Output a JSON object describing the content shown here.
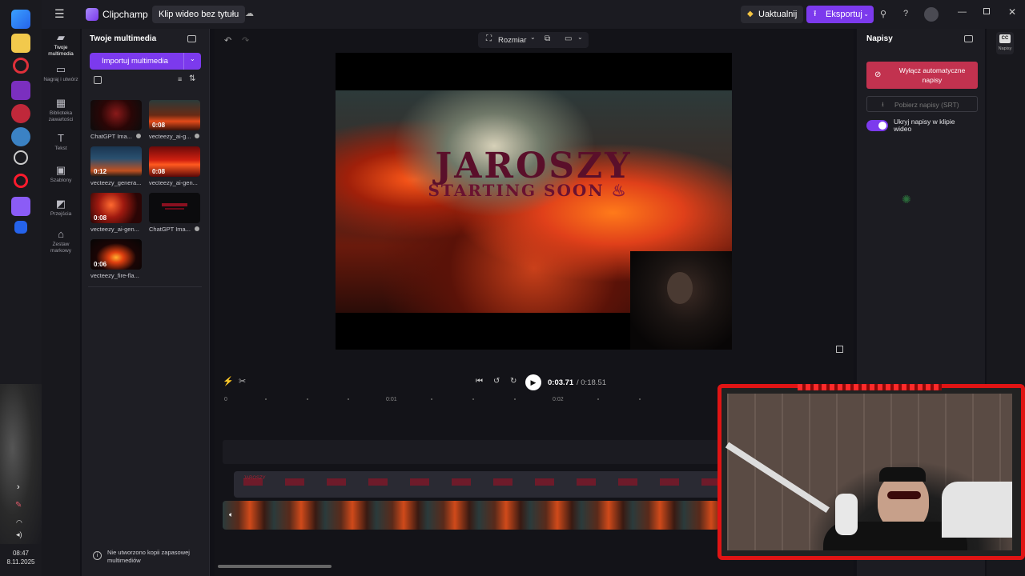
{
  "os_taskbar": {
    "time": "08:47",
    "date": "8.11.2025"
  },
  "topbar": {
    "app_name": "Clipchamp",
    "project_title": "Klip wideo bez tytułu",
    "upgrade_label": "Uaktualnij",
    "export_label": "Eksportuj",
    "help_label": "?"
  },
  "leftnav": {
    "items": [
      {
        "label": "Twoje multimedia",
        "icon": "folder-icon"
      },
      {
        "label": "Nagraj i utwórz",
        "icon": "camera-icon"
      },
      {
        "label": "Biblioteka zawartości",
        "icon": "library-icon"
      },
      {
        "label": "Tekst",
        "icon": "text-icon"
      },
      {
        "label": "Szablony",
        "icon": "templates-icon"
      },
      {
        "label": "Przejścia",
        "icon": "transitions-icon"
      },
      {
        "label": "Zestaw markowy",
        "icon": "brand-kit-icon"
      }
    ]
  },
  "media": {
    "title": "Twoje multimedia",
    "import_label": "Importuj multimedia",
    "items": [
      {
        "label": "ChatGPT Ima...",
        "duration": ""
      },
      {
        "label": "vecteezy_ai-g...",
        "duration": "0:08"
      },
      {
        "label": "vecteezy_genera...",
        "duration": "0:12"
      },
      {
        "label": "vecteezy_ai-gen...",
        "duration": "0:08"
      },
      {
        "label": "vecteezy_ai-gen...",
        "duration": "0:08"
      },
      {
        "label": "ChatGPT Ima...",
        "duration": ""
      },
      {
        "label": "vecteezy_fire-fla...",
        "duration": "0:06"
      }
    ],
    "backup_notice": "Nie utworzono kopii zapasowej multimediów"
  },
  "preview": {
    "size_label": "Rozmiar",
    "title_text": "JAROSZY",
    "subtitle_text": "STARTING SOON",
    "current_time": "0:03.71",
    "total_time": "/ 0:18.51"
  },
  "timeline": {
    "ruler": [
      "0",
      "0:01",
      "0:02"
    ],
    "text_clip_label": "JAROSZY"
  },
  "captions": {
    "title": "Napisy",
    "disable_auto_label": "Wyłącz automatyczne napisy",
    "download_srt_label": "Pobierz napisy (SRT)",
    "hide_toggle_label": "Ukryj napisy w klipie wideo",
    "strip_label": "Napisy"
  },
  "colors": {
    "accent": "#7c3aed",
    "caption_btn": "#c2324f"
  }
}
